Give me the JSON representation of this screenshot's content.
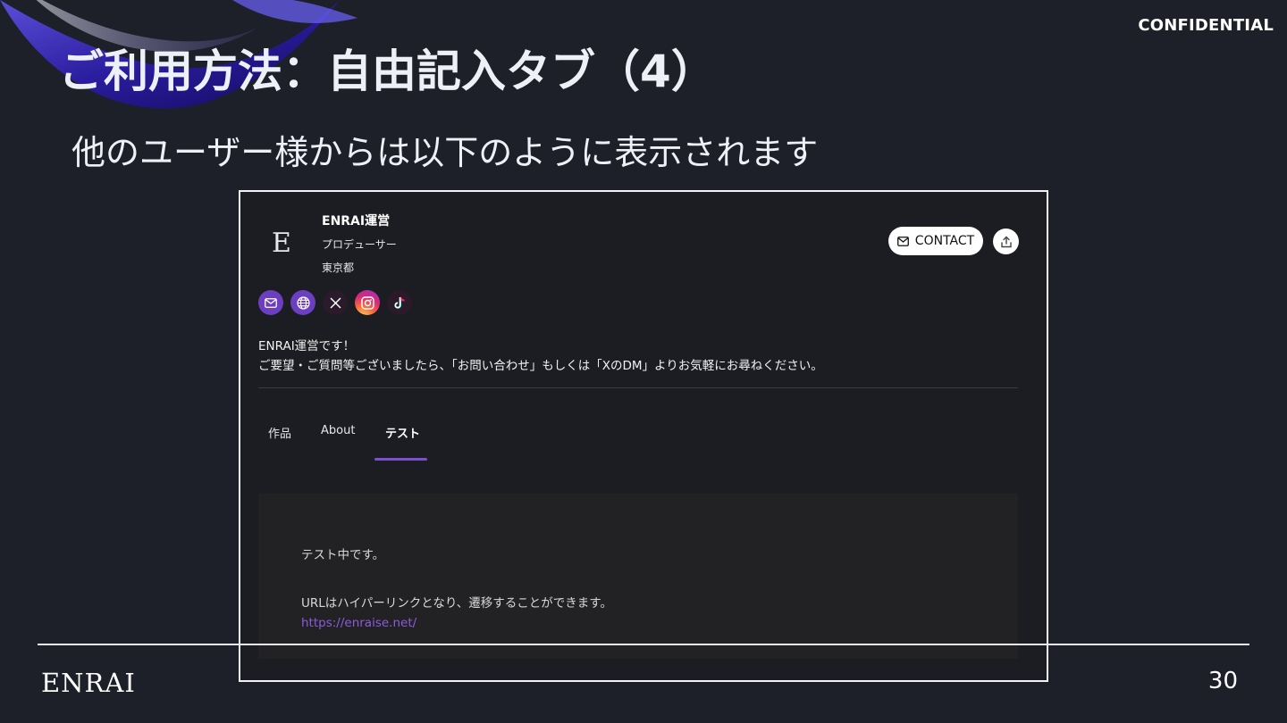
{
  "slide": {
    "confidential_label": "CONFIDENTIAL",
    "title": "ご利用方法：自由記入タブ（4）",
    "subtitle": "他のユーザー様からは以下のように表示されます",
    "footer_logo": "ENRAI",
    "page_number": "30"
  },
  "profile": {
    "avatar_letter": "E",
    "name": "ENRAI運営",
    "role": "プロデューサー",
    "location": "東京都",
    "contact_label": "CONTACT",
    "socials": [
      {
        "name": "mail",
        "icon": "mail-icon"
      },
      {
        "name": "website",
        "icon": "globe-icon"
      },
      {
        "name": "x",
        "icon": "x-icon"
      },
      {
        "name": "instagram",
        "icon": "instagram-icon"
      },
      {
        "name": "tiktok",
        "icon": "tiktok-icon"
      }
    ],
    "bio_line1": "ENRAI運営です！",
    "bio_line2": "ご要望・ご質問等ございましたら、「お問い合わせ」もしくは「XのDM」よりお気軽にお尋ねください。"
  },
  "tabs": [
    {
      "label": "作品",
      "active": false
    },
    {
      "label": "About",
      "active": false
    },
    {
      "label": "テスト",
      "active": true
    }
  ],
  "content": {
    "line1": "テスト中です。",
    "line2": "URLはハイパーリンクとなり、遷移することができます。",
    "link": "https://enraise.net/"
  },
  "colors": {
    "background": "#1d1f29",
    "accent": "#7c4fd0",
    "link": "#8b5bdc"
  }
}
